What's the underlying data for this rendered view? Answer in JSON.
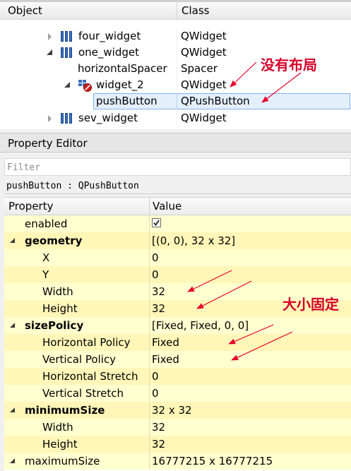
{
  "object_inspector": {
    "col_object": "Object",
    "col_class": "Class",
    "rows": [
      {
        "name": "four_widget",
        "class": "QWidget"
      },
      {
        "name": "one_widget",
        "class": "QWidget"
      },
      {
        "name": "horizontalSpacer",
        "class": "Spacer"
      },
      {
        "name": "widget_2",
        "class": "QWidget"
      },
      {
        "name": "pushButton",
        "class": "QPushButton"
      },
      {
        "name": "sev_widget",
        "class": "QWidget"
      }
    ]
  },
  "property_editor": {
    "title": "Property Editor",
    "filter_placeholder": "Filter",
    "object_label": "pushButton : QPushButton",
    "col_property": "Property",
    "col_value": "Value",
    "rows": [
      {
        "name": "enabled",
        "value": ""
      },
      {
        "name": "geometry",
        "value": "[(0, 0), 32 x 32]"
      },
      {
        "name": "X",
        "value": "0"
      },
      {
        "name": "Y",
        "value": "0"
      },
      {
        "name": "Width",
        "value": "32"
      },
      {
        "name": "Height",
        "value": "32"
      },
      {
        "name": "sizePolicy",
        "value": "[Fixed, Fixed, 0, 0]"
      },
      {
        "name": "Horizontal Policy",
        "value": "Fixed"
      },
      {
        "name": "Vertical Policy",
        "value": "Fixed"
      },
      {
        "name": "Horizontal Stretch",
        "value": "0"
      },
      {
        "name": "Vertical Stretch",
        "value": "0"
      },
      {
        "name": "minimumSize",
        "value": "32 x 32"
      },
      {
        "name": "Width",
        "value": "32"
      },
      {
        "name": "Height",
        "value": "32"
      },
      {
        "name": "maximumSize",
        "value": "16777215 x 16777215"
      }
    ],
    "enabled_checked": true
  },
  "annotations": {
    "no_layout": "没有布局",
    "fixed_size": "大小固定"
  },
  "colors": {
    "annotation": "#d6002a",
    "row_yellow_light": "#ffffcf",
    "row_yellow_dark": "#fff6b8",
    "selection": "#d9e9fb"
  }
}
